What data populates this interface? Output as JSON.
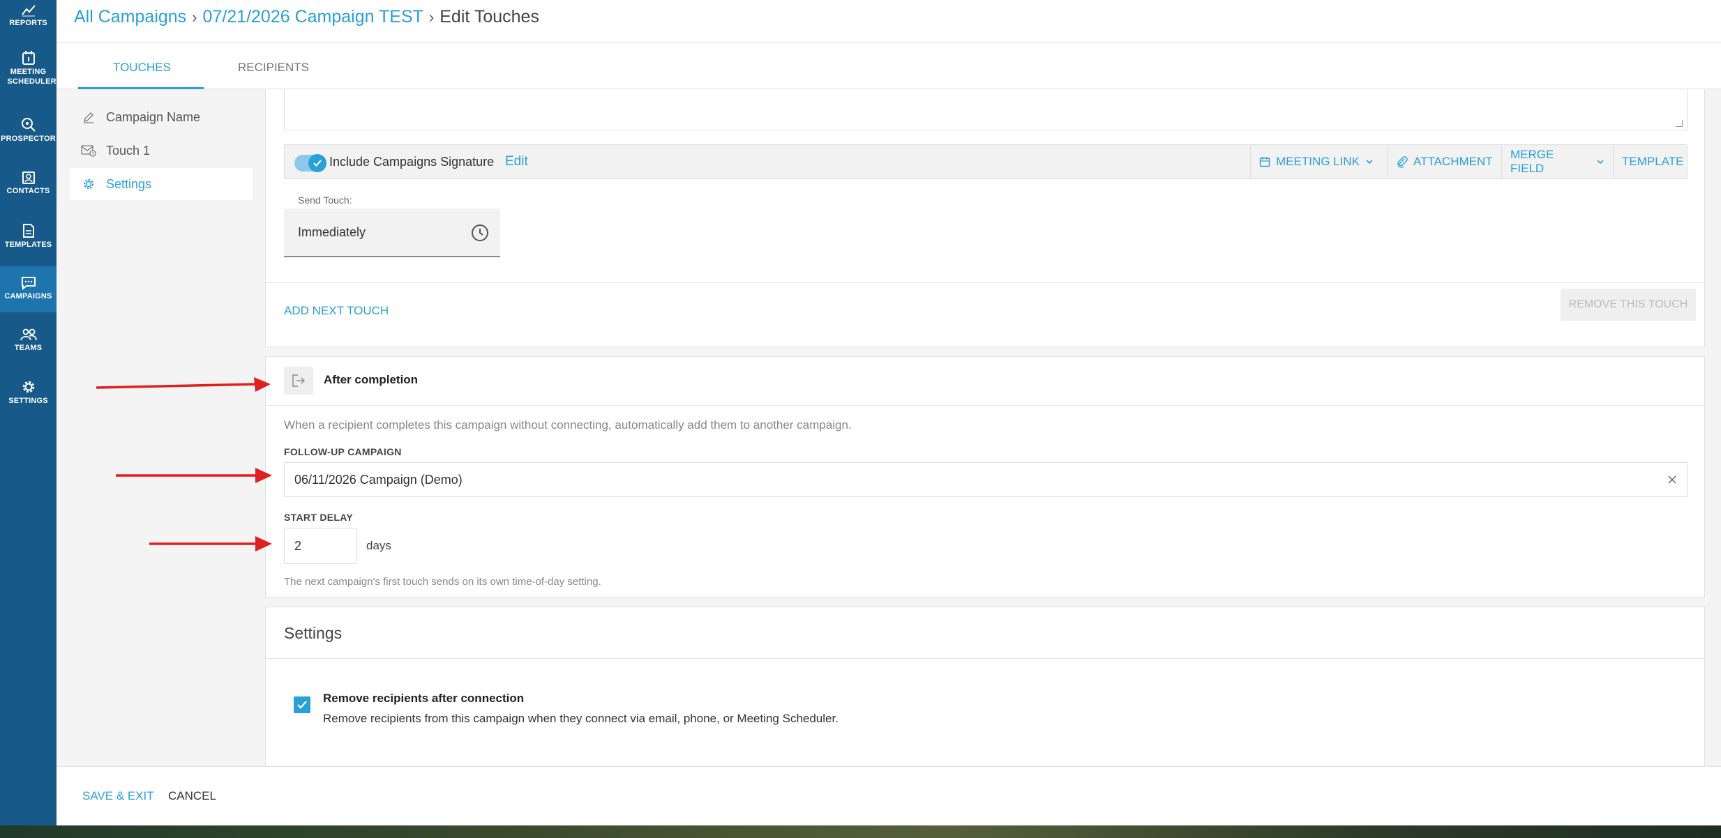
{
  "nav": {
    "items": [
      {
        "label": "REPORTS",
        "icon": "chart-line-icon"
      },
      {
        "label": "MEETING SCHEDULER",
        "icon": "calendar-icon"
      },
      {
        "label": "PROSPECTOR",
        "icon": "magnify-icon"
      },
      {
        "label": "CONTACTS",
        "icon": "contact-card-icon"
      },
      {
        "label": "TEMPLATES",
        "icon": "document-icon"
      },
      {
        "label": "CAMPAIGNS",
        "icon": "chat-bubble-icon"
      },
      {
        "label": "TEAMS",
        "icon": "people-icon"
      },
      {
        "label": "SETTINGS",
        "icon": "gear-icon"
      }
    ],
    "active": "CAMPAIGNS"
  },
  "breadcrumb": {
    "root": "All Campaigns",
    "campaign": "07/21/2026 Campaign TEST",
    "current": "Edit Touches"
  },
  "tabs": [
    {
      "label": "TOUCHES"
    },
    {
      "label": "RECIPIENTS"
    }
  ],
  "sections": [
    {
      "label": "Campaign Name",
      "icon": "pencil-icon"
    },
    {
      "label": "Touch 1",
      "icon": "envelope-clock-icon"
    },
    {
      "label": "Settings",
      "icon": "gear-icon"
    }
  ],
  "touch": {
    "signature_label": "Include Campaigns Signature",
    "signature_enabled": true,
    "edit_label": "Edit",
    "toolbar": {
      "meeting_link": "MEETING LINK",
      "attachment": "ATTACHMENT",
      "merge_field": "MERGE FIELD",
      "template": "TEMPLATE"
    },
    "send_label": "Send Touch:",
    "send_value": "Immediately",
    "add_next": "ADD NEXT TOUCH",
    "remove": "REMOVE THIS TOUCH"
  },
  "after": {
    "title": "After completion",
    "description": "When a recipient completes this campaign without connecting, automatically add them to another campaign.",
    "followup_label": "FOLLOW-UP CAMPAIGN",
    "followup_value": "06/11/2026 Campaign (Demo)",
    "delay_label": "START DELAY",
    "delay_value": "2",
    "delay_unit": "days",
    "hint": "The next campaign's first touch sends on its own time-of-day setting."
  },
  "settings": {
    "title": "Settings",
    "remove_title": "Remove recipients after connection",
    "remove_desc": "Remove recipients from this campaign when they connect via email, phone, or Meeting Scheduler.",
    "remove_checked": true
  },
  "footer": {
    "save_exit": "SAVE & EXIT",
    "cancel": "CANCEL"
  },
  "colors": {
    "sidebar": "#175a8a",
    "sidebar_active": "#1e74ad",
    "accent": "#2a9fd8",
    "annotation_arrow": "#e02020"
  }
}
